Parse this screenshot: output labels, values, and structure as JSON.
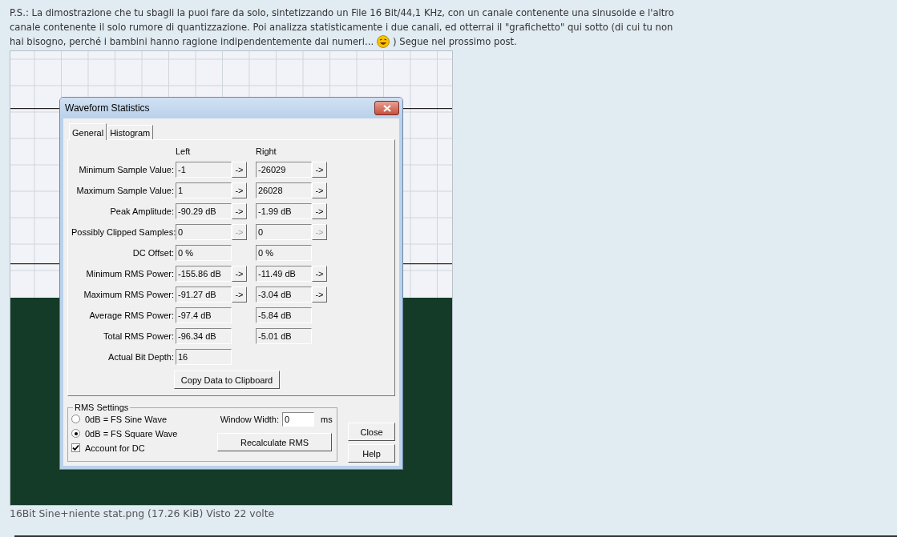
{
  "post": {
    "lines": [
      "P.S.: La dimostrazione che tu sbagli la puoi fare da solo, sintetizzando un File 16 Bit/44,1 KHz, con un canale contenente una sinusoide e l'altro",
      "canale contenente il solo rumore di quantizzazione. Poi analizza statisticamente i due canali, ed otterrai il \"grafichetto\" qui sotto (di cui tu non",
      "hai bisogno, perché i bambini hanno ragione indipendentemente dai numeri..."
    ],
    "text_after": ") Segue nel prossimo post."
  },
  "attachment": {
    "caption": "16Bit Sine+niente stat.png (17.26 KiB) Visto 22 volte"
  },
  "dialog": {
    "title": "Waveform Statistics",
    "tabs": [
      {
        "label": "General",
        "selected": true
      },
      {
        "label": "Histogram",
        "selected": false
      }
    ],
    "column_headers": [
      "Left",
      "Right"
    ],
    "rows": [
      {
        "label": "Minimum Sample Value:",
        "left": {
          "value": "-1",
          "arrow": "->",
          "disabled": false
        },
        "right": {
          "value": "-26029",
          "arrow": "->",
          "disabled": false
        }
      },
      {
        "label": "Maximum Sample Value:",
        "left": {
          "value": "1",
          "arrow": "->",
          "disabled": false
        },
        "right": {
          "value": "26028",
          "arrow": "->",
          "disabled": false
        }
      },
      {
        "label": "Peak Amplitude:",
        "left": {
          "value": "-90.29 dB",
          "arrow": "->",
          "disabled": false
        },
        "right": {
          "value": "-1.99 dB",
          "arrow": "->",
          "disabled": false
        }
      },
      {
        "label": "Possibly Clipped Samples:",
        "left": {
          "value": "0",
          "arrow": "->",
          "disabled": true
        },
        "right": {
          "value": "0",
          "arrow": "->",
          "disabled": true
        }
      },
      {
        "label": "DC Offset:",
        "left": {
          "value": "0 %"
        },
        "right": {
          "value": "0 %"
        }
      },
      {
        "label": "Minimum RMS Power:",
        "left": {
          "value": "-155.86 dB",
          "arrow": "->",
          "disabled": false
        },
        "right": {
          "value": "-11.49 dB",
          "arrow": "->",
          "disabled": false
        }
      },
      {
        "label": "Maximum RMS Power:",
        "left": {
          "value": "-91.27 dB",
          "arrow": "->",
          "disabled": false
        },
        "right": {
          "value": "-3.04 dB",
          "arrow": "->",
          "disabled": false
        }
      },
      {
        "label": "Average RMS Power:",
        "left": {
          "value": "-97.4 dB"
        },
        "right": {
          "value": "-5.84 dB"
        }
      },
      {
        "label": "Total RMS Power:",
        "left": {
          "value": "-96.34 dB"
        },
        "right": {
          "value": "-5.01 dB"
        }
      },
      {
        "label": "Actual Bit Depth:",
        "left": {
          "value": "16"
        }
      }
    ],
    "copy_button": "Copy Data to Clipboard",
    "rms_settings": {
      "title": "RMS Settings",
      "options": [
        {
          "label": "0dB = FS Sine Wave",
          "selected": false
        },
        {
          "label": "0dB = FS Square Wave",
          "selected": true
        }
      ],
      "checkbox": {
        "label": "Account for DC",
        "checked": true
      },
      "window_width": {
        "label": "Window Width:",
        "value": "0",
        "unit": "ms"
      },
      "recalculate_button": "Recalculate RMS"
    },
    "buttons": [
      "Close",
      "Help"
    ]
  }
}
